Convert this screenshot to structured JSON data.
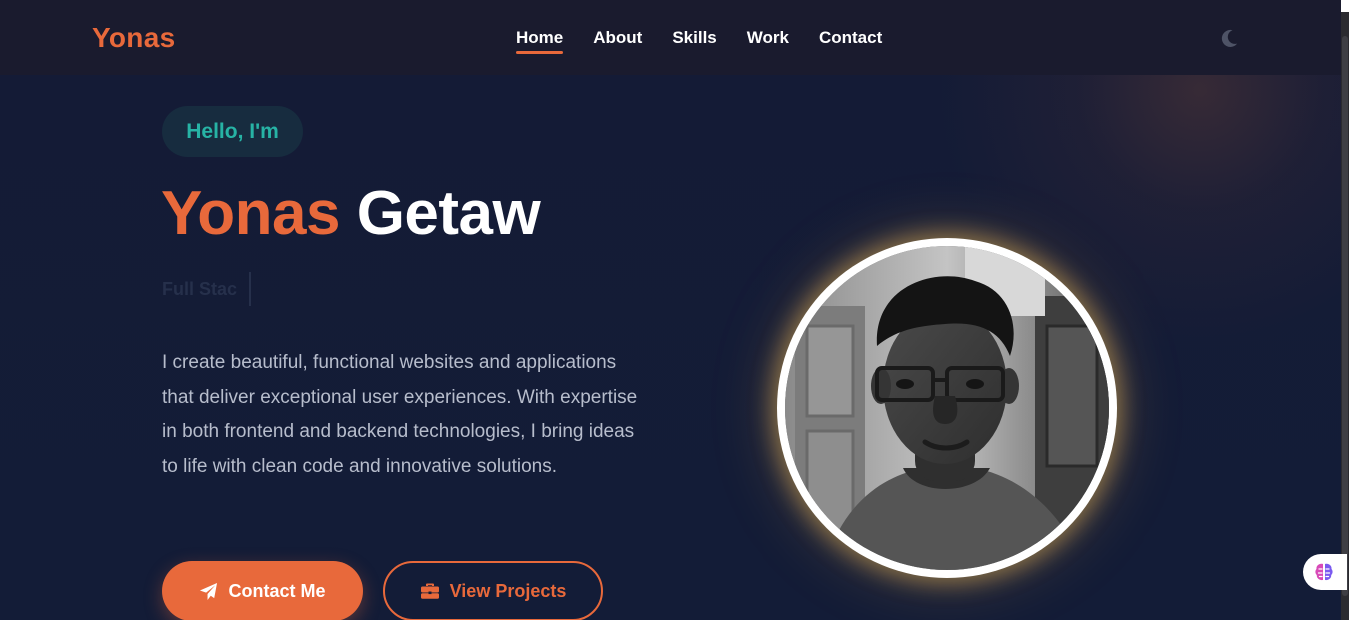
{
  "colors": {
    "accent": "#e8693b",
    "teal": "#27b3a5",
    "background": "#131c37",
    "navbar": "#1a1b2e",
    "text_light": "#ffffff",
    "text_muted": "#b7bdcc"
  },
  "navbar": {
    "logo": "Yonas",
    "links": [
      {
        "label": "Home",
        "active": true
      },
      {
        "label": "About",
        "active": false
      },
      {
        "label": "Skills",
        "active": false
      },
      {
        "label": "Work",
        "active": false
      },
      {
        "label": "Contact",
        "active": false
      }
    ],
    "theme_icon": "moon-icon"
  },
  "hero": {
    "greeting": "Hello, I'm",
    "first_name": "Yonas",
    "last_name": "Getaw",
    "typing_text": "Full Stac",
    "description": "I create beautiful, functional websites and applications that deliver exceptional user experiences. With expertise in both frontend and backend technologies, I bring ideas to life with clean code and innovative solutions.",
    "buttons": {
      "primary": {
        "label": "Contact Me",
        "icon": "paper-plane-icon"
      },
      "secondary": {
        "label": "View Projects",
        "icon": "briefcase-icon"
      }
    }
  },
  "portrait": {
    "icon": "profile-photo"
  },
  "widget": {
    "icon": "brain-icon"
  }
}
